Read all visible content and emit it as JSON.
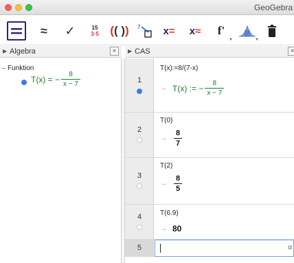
{
  "window": {
    "title": "GeoGebra"
  },
  "toolbar": {
    "tools": [
      {
        "name": "evaluate",
        "label": "="
      },
      {
        "name": "numeric",
        "label": "≈"
      },
      {
        "name": "keep-input",
        "label": "✓"
      },
      {
        "name": "factor-top",
        "label": "15"
      },
      {
        "name": "factor-bottom",
        "label": "3·5"
      },
      {
        "name": "expand",
        "label": "( )"
      },
      {
        "name": "substitute",
        "label": "7"
      },
      {
        "name": "solve",
        "label": "x="
      },
      {
        "name": "solve-numeric",
        "label": "x="
      },
      {
        "name": "derivative",
        "label": "f'"
      },
      {
        "name": "probability",
        "label": ""
      },
      {
        "name": "delete",
        "label": ""
      }
    ]
  },
  "algebra": {
    "header": "Algebra",
    "close": "×",
    "group": "Funktion",
    "item": {
      "lhs": "T(x) = −",
      "num": "8",
      "den": "x − 7"
    }
  },
  "cas": {
    "header": "CAS",
    "close": "×",
    "rows": [
      {
        "n": "1",
        "input": "T(x):=8/(7-x)",
        "out_prefix": "T(x) := −",
        "out_num": "8",
        "out_den": "x − 7"
      },
      {
        "n": "2",
        "input": "T(0)",
        "out_num": "8",
        "out_den": "7"
      },
      {
        "n": "3",
        "input": "T(2)",
        "out_num": "8",
        "out_den": "5"
      },
      {
        "n": "4",
        "input": "T(6.9)",
        "out_value": "80"
      },
      {
        "n": "5",
        "input": "",
        "alpha": "α"
      }
    ],
    "arrow": "→"
  },
  "colors": {
    "green": "#1a7e2a",
    "blue": "#3d7ce8",
    "activeBorder": "#23237a"
  }
}
